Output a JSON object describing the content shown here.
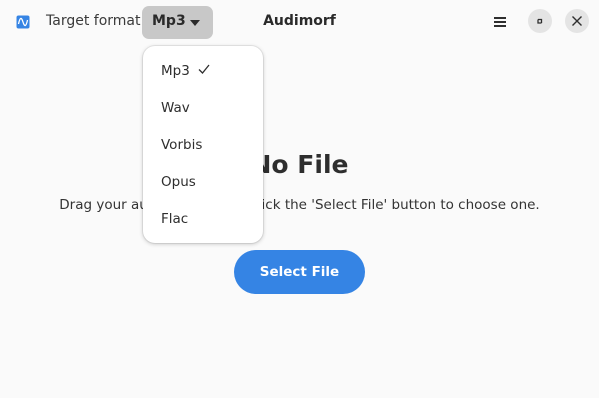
{
  "header": {
    "target_label": "Target format",
    "selected_format": "Mp3",
    "title": "Audimorf"
  },
  "status": {
    "title": "No File",
    "description": "Drag your audio file here or click the 'Select File' button to choose one."
  },
  "select_button_label": "Select File",
  "format_options": [
    "Mp3",
    "Wav",
    "Vorbis",
    "Opus",
    "Flac"
  ],
  "selected_option": "Mp3",
  "colors": {
    "accent": "#3584e4",
    "app_icon": "#3584e4"
  },
  "icons": [
    "waveform-app-icon",
    "pan-down-icon",
    "hamburger-menu-icon",
    "unmaximize-icon",
    "close-icon",
    "checkmark-icon"
  ]
}
